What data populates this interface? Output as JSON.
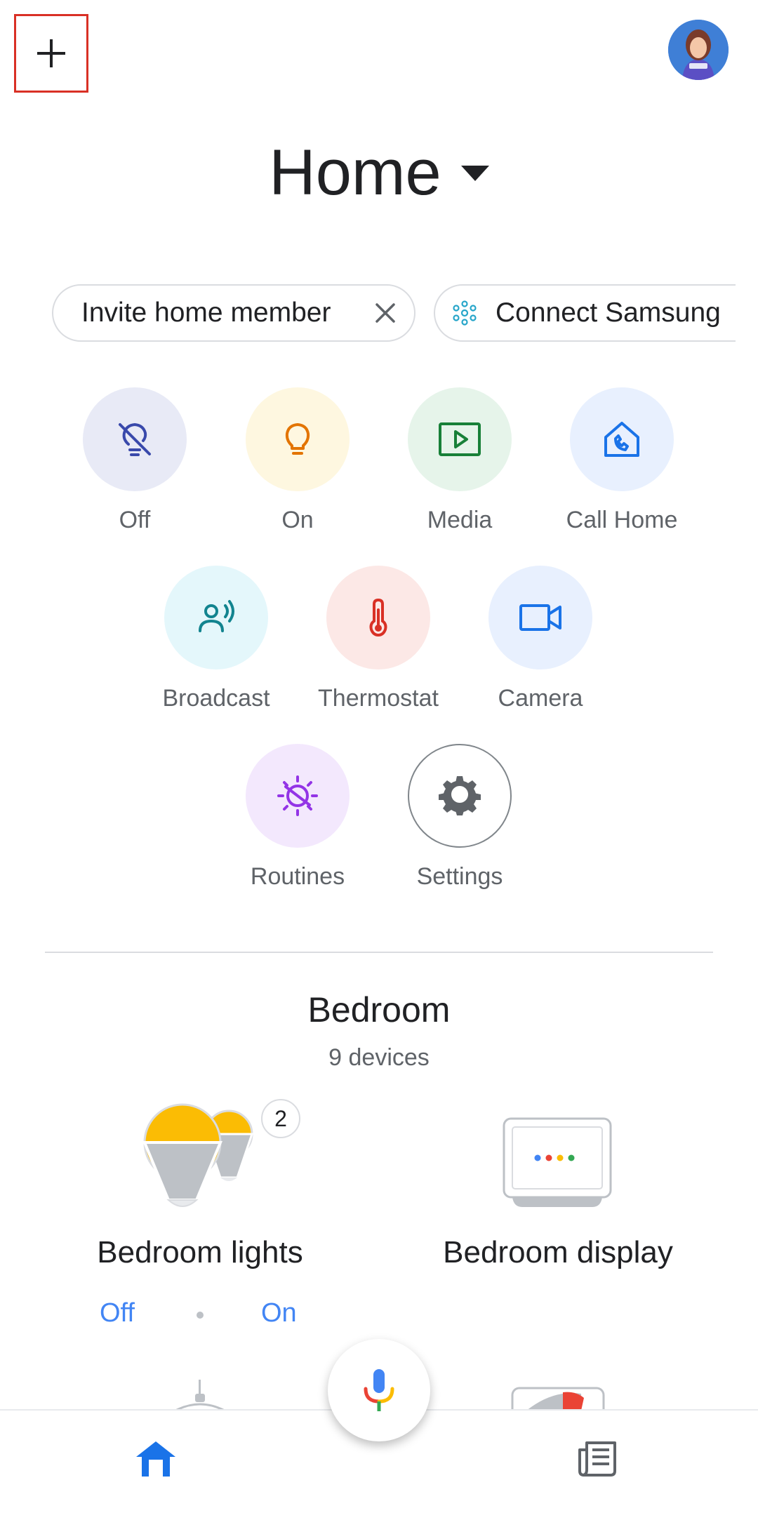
{
  "header": {
    "add_icon": "plus-icon",
    "avatar_icon": "account-avatar"
  },
  "title": {
    "text": "Home",
    "dropdown_icon": "caret-down-icon"
  },
  "chips": {
    "invite": {
      "label": "Invite home member",
      "dismiss_icon": "close-icon"
    },
    "connect": {
      "label": "Connect Samsung",
      "icon": "smartthings-icon"
    }
  },
  "actions": [
    {
      "label": "Off",
      "icon": "light-off-icon",
      "bg": "#e8eaf6",
      "color": "#3949ab"
    },
    {
      "label": "On",
      "icon": "light-on-icon",
      "bg": "#fef7e0",
      "color": "#e37400"
    },
    {
      "label": "Media",
      "icon": "media-play-icon",
      "bg": "#e6f4ea",
      "color": "#188038"
    },
    {
      "label": "Call Home",
      "icon": "call-home-icon",
      "bg": "#e8f0fe",
      "color": "#1a73e8"
    },
    {
      "label": "Broadcast",
      "icon": "broadcast-icon",
      "bg": "#e4f7fb",
      "color": "#12848f"
    },
    {
      "label": "Thermostat",
      "icon": "thermostat-icon",
      "bg": "#fce8e6",
      "color": "#d93025"
    },
    {
      "label": "Camera",
      "icon": "camera-icon",
      "bg": "#e8f0fe",
      "color": "#1a73e8"
    },
    {
      "label": "Routines",
      "icon": "routines-icon",
      "bg": "#f3e8fd",
      "color": "#9334e6"
    },
    {
      "label": "Settings",
      "icon": "gear-icon",
      "bg": "#ffffff",
      "color": "#5f6368"
    }
  ],
  "room": {
    "title": "Bedroom",
    "count": "9 devices"
  },
  "devices": {
    "lights": {
      "label": "Bedroom lights",
      "badge": "2",
      "off": "Off",
      "on": "On"
    },
    "display": {
      "label": "Bedroom display"
    }
  },
  "nav": {
    "home_icon": "home-icon",
    "mic_icon": "mic-icon",
    "feed_icon": "feed-icon"
  }
}
